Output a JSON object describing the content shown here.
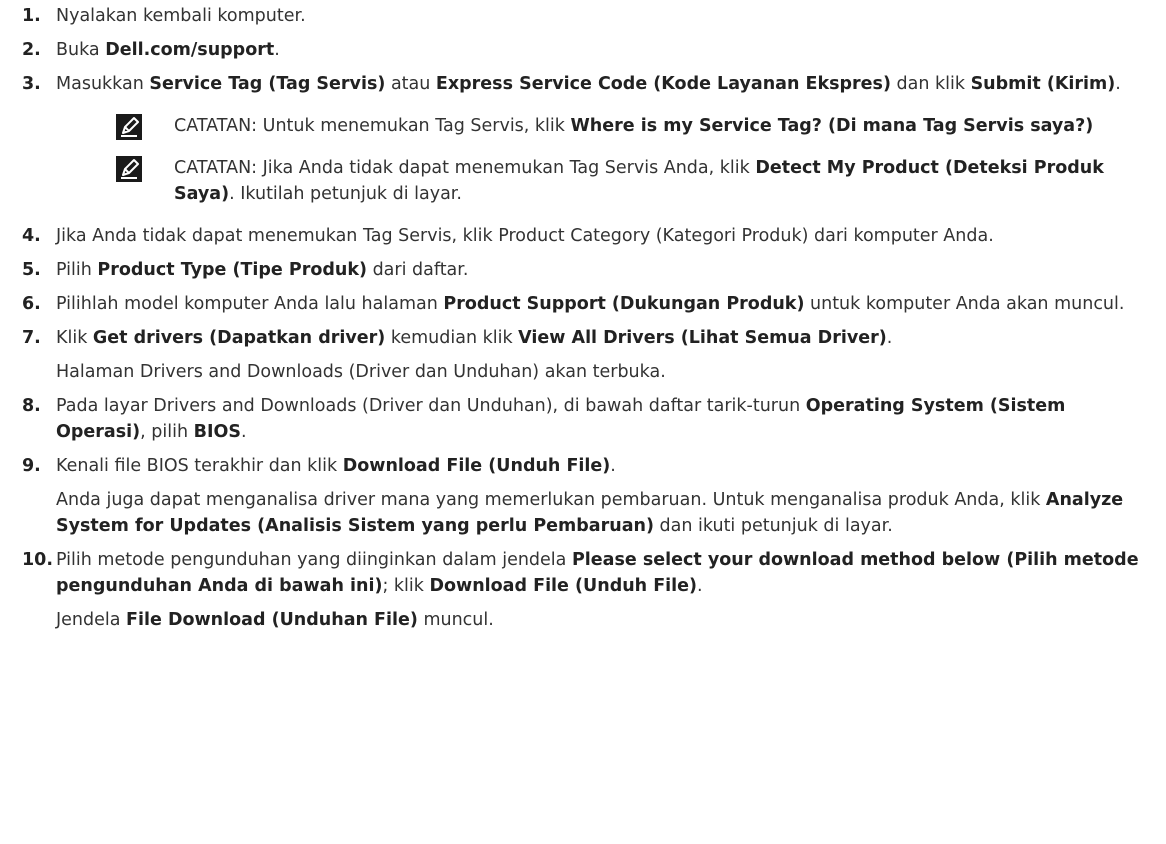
{
  "steps": [
    {
      "num": "1.",
      "parts": [
        {
          "t": "Nyalakan kembali komputer."
        }
      ]
    },
    {
      "num": "2.",
      "parts": [
        {
          "t": "Buka "
        },
        {
          "t": "Dell.com/support",
          "b": true
        },
        {
          "t": "."
        }
      ]
    },
    {
      "num": "3.",
      "parts": [
        {
          "t": "Masukkan "
        },
        {
          "t": "Service Tag (Tag Servis)",
          "b": true
        },
        {
          "t": " atau "
        },
        {
          "t": "Express Service Code (Kode Layanan Ekspres)",
          "b": true
        },
        {
          "t": " dan klik "
        },
        {
          "t": "Submit (Kirim)",
          "b": true
        },
        {
          "t": "."
        }
      ],
      "notes": [
        {
          "icon": "note-pencil-icon",
          "parts": [
            {
              "t": "CATATAN:",
              "label": true
            },
            {
              "t": " Untuk menemukan Tag Servis, klik "
            },
            {
              "t": "Where is my Service Tag? (Di mana Tag Servis saya?)",
              "b": true
            }
          ]
        },
        {
          "icon": "note-pencil-icon",
          "parts": [
            {
              "t": "CATATAN:",
              "label": true
            },
            {
              "t": " Jika Anda tidak dapat menemukan Tag Servis Anda, klik "
            },
            {
              "t": "Detect My Product (Deteksi Produk Saya)",
              "b": true
            },
            {
              "t": ". Ikutilah petunjuk di layar."
            }
          ]
        }
      ]
    },
    {
      "num": "4.",
      "parts": [
        {
          "t": "Jika Anda tidak dapat menemukan Tag Servis, klik Product Category (Kategori Produk) dari komputer Anda."
        }
      ]
    },
    {
      "num": "5.",
      "parts": [
        {
          "t": "Pilih "
        },
        {
          "t": "Product Type (Tipe Produk)",
          "b": true
        },
        {
          "t": " dari daftar."
        }
      ]
    },
    {
      "num": "6.",
      "parts": [
        {
          "t": "Pilihlah model komputer Anda lalu halaman "
        },
        {
          "t": "Product Support (Dukungan Produk)",
          "b": true
        },
        {
          "t": " untuk komputer Anda akan muncul."
        }
      ]
    },
    {
      "num": "7.",
      "parts": [
        {
          "t": "Klik "
        },
        {
          "t": "Get drivers (Dapatkan driver)",
          "b": true
        },
        {
          "t": " kemudian klik "
        },
        {
          "t": "View All Drivers (Lihat Semua Driver)",
          "b": true
        },
        {
          "t": "."
        }
      ],
      "follow": [
        [
          {
            "t": "Halaman Drivers and Downloads (Driver dan Unduhan) akan terbuka."
          }
        ]
      ]
    },
    {
      "num": "8.",
      "parts": [
        {
          "t": "Pada layar Drivers and Downloads (Driver dan Unduhan), di bawah daftar tarik-turun "
        },
        {
          "t": "Operating System (Sistem Operasi)",
          "b": true
        },
        {
          "t": ", pilih "
        },
        {
          "t": "BIOS",
          "b": true
        },
        {
          "t": "."
        }
      ]
    },
    {
      "num": "9.",
      "parts": [
        {
          "t": "Kenali file BIOS terakhir dan klik "
        },
        {
          "t": "Download File (Unduh File)",
          "b": true
        },
        {
          "t": "."
        }
      ],
      "follow": [
        [
          {
            "t": "Anda juga dapat menganalisa driver mana yang memerlukan pembaruan. Untuk menganalisa produk Anda, klik "
          },
          {
            "t": "Analyze System for Updates (Analisis Sistem yang perlu Pembaruan)",
            "b": true
          },
          {
            "t": " dan ikuti petunjuk di layar."
          }
        ]
      ]
    },
    {
      "num": "10.",
      "parts": [
        {
          "t": "Pilih metode pengunduhan yang diinginkan dalam jendela "
        },
        {
          "t": "Please select your download method below (Pilih metode pengunduhan Anda di bawah ini)",
          "b": true
        },
        {
          "t": "; klik "
        },
        {
          "t": "Download File (Unduh File)",
          "b": true
        },
        {
          "t": "."
        }
      ],
      "follow": [
        [
          {
            "t": "Jendela "
          },
          {
            "t": "File Download (Unduhan File)",
            "b": true
          },
          {
            "t": " muncul."
          }
        ]
      ]
    }
  ]
}
